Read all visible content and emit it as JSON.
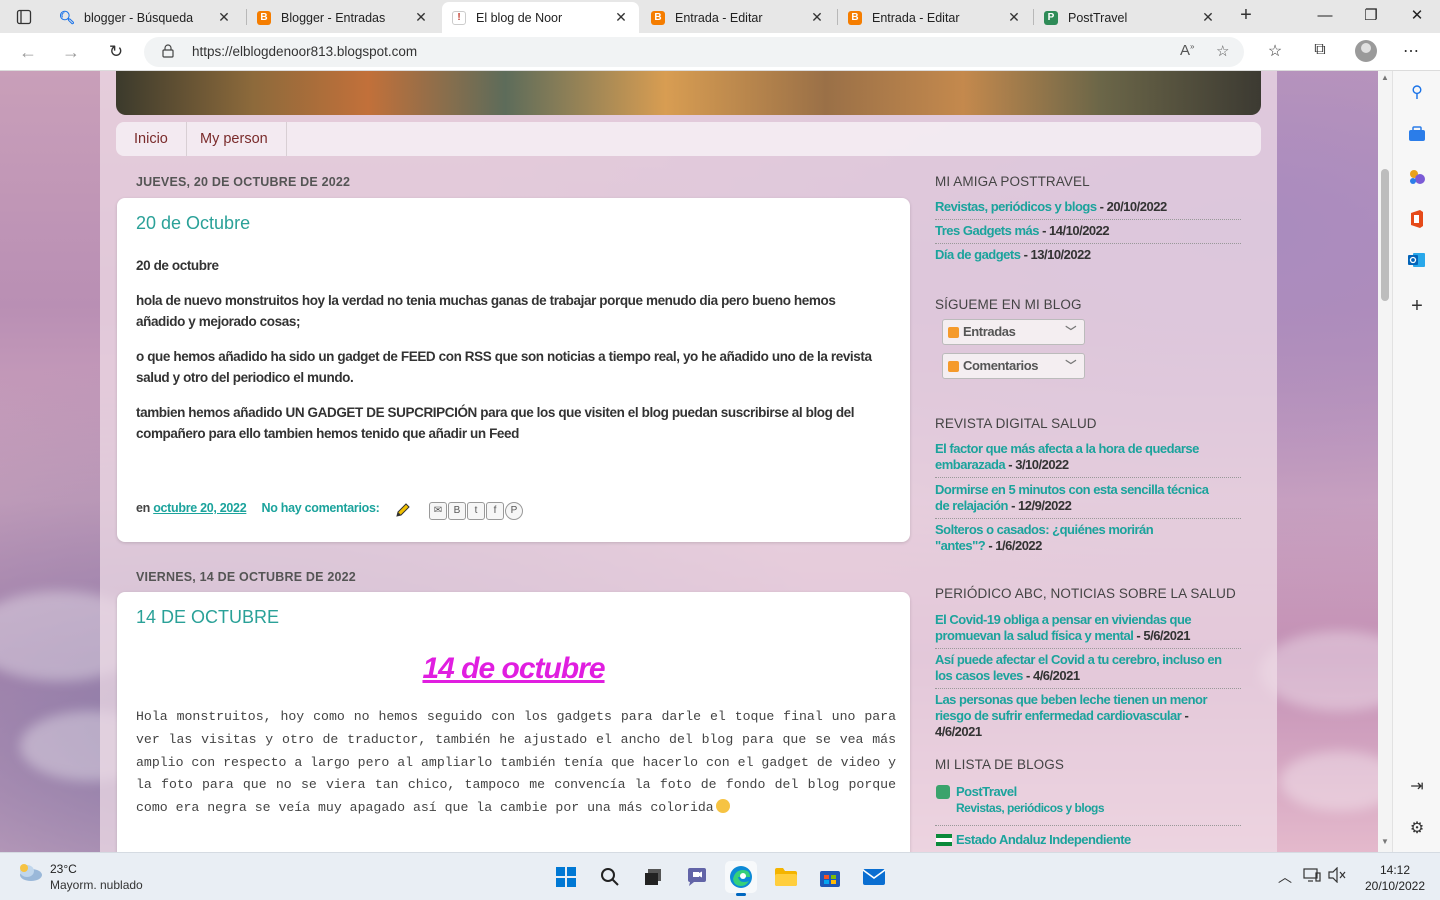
{
  "browser": {
    "tabs": [
      {
        "title": "blogger - Búsqueda",
        "favicon": "search-icon",
        "color": "#1a73e8",
        "active": false
      },
      {
        "title": "Blogger - Entradas",
        "favicon": "blogger-icon",
        "color": "#f57d00",
        "active": false
      },
      {
        "title": "El blog de Noor",
        "favicon": "blog-icon",
        "color": "#c0392b",
        "active": true
      },
      {
        "title": "Entrada - Editar",
        "favicon": "blogger-icon",
        "color": "#f57d00",
        "active": false
      },
      {
        "title": "Entrada - Editar",
        "favicon": "blogger-icon",
        "color": "#f57d00",
        "active": false
      },
      {
        "title": "PostTravel",
        "favicon": "posttravel-icon",
        "color": "#2e8b57",
        "active": false
      }
    ],
    "url": "https://elblogdenoor813.blogspot.com"
  },
  "blog": {
    "nav": [
      "Inicio",
      "My person"
    ],
    "post1": {
      "date_header": "JUEVES, 20 DE OCTUBRE DE 2022",
      "title": "20 de Octubre",
      "paragraphs": [
        " 20 de octubre",
        "hola de nuevo monstruitos hoy la verdad no tenia muchas ganas de trabajar porque menudo dia pero bueno hemos añadido y mejorado cosas;",
        "o que hemos añadido ha sido un gadget de FEED con RSS que son noticias a tiempo real, yo he añadido uno de la revista salud y otro del periodico el mundo.",
        "tambien hemos añadido UN GADGET DE SUPCRIPCIÓN para que los que visiten el blog puedan suscribirse al blog del compañero para ello tambien hemos tenido que añadir un Feed"
      ],
      "footer_prefix": "en",
      "footer_date": "octubre 20, 2022",
      "footer_comments": "No hay comentarios:"
    },
    "post2": {
      "date_header": "VIERNES, 14 DE OCTUBRE DE 2022",
      "title": "14 DE OCTUBRE",
      "big_title": "14 de octubre",
      "body": "Hola monstruitos, hoy como no hemos seguido con los gadgets para darle el toque final uno para ver las visitas y otro de traductor, también he ajustado el ancho del blog para que se vea más amplio con respecto a largo pero al ampliarlo también tenía que hacerlo con el gadget de video y la foto para que no se viera tan chico, tampoco me convencía la foto de fondo del blog porque como era negra se veía muy apagado así que la cambie por una más colorida"
    },
    "sidebar": {
      "amiga": {
        "heading": "MI AMIGA POSTTRAVEL",
        "items": [
          {
            "link": "Revistas, periódicos y blogs",
            "date": " - 20/10/2022"
          },
          {
            "link": "Tres Gadgets más",
            "date": " - 14/10/2022"
          },
          {
            "link": "Día de gadgets",
            "date": " - 13/10/2022"
          }
        ]
      },
      "siguenos": {
        "heading": "SÍGUEME EN MI BLOG",
        "buttons": [
          "Entradas",
          "Comentarios"
        ]
      },
      "revista": {
        "heading": "REVISTA DIGITAL SALUD",
        "items": [
          {
            "link": "El factor que más afecta a la hora de quedarse embarazada",
            "date": " - 3/10/2022"
          },
          {
            "link": "Dormirse en 5 minutos con esta sencilla técnica de relajación",
            "date": " - 12/9/2022"
          },
          {
            "link": "Solteros o casados: ¿quiénes morirán \"antes\"?",
            "date": " - 1/6/2022"
          }
        ]
      },
      "periodico": {
        "heading": "PERIÓDICO ABC, NOTICIAS SOBRE LA SALUD",
        "items": [
          {
            "link": "El Covid-19 obliga a pensar en viviendas que promuevan la salud física y mental",
            "date": " - 5/6/2021"
          },
          {
            "link": "Así puede afectar el Covid a tu cerebro, incluso en los casos leves",
            "date": " - 4/6/2021"
          },
          {
            "link": "Las personas que beben leche tienen un menor riesgo de sufrir enfermedad cardiovascular",
            "date": " - 4/6/2021"
          }
        ]
      },
      "lista": {
        "heading": "MI LISTA DE BLOGS",
        "items": [
          {
            "name": "PostTravel",
            "sub": "Revistas, periódicos y blogs"
          },
          {
            "name": "Estado Andaluz Independiente",
            "sub": ""
          }
        ]
      }
    }
  },
  "taskbar": {
    "weather_temp": "23°C",
    "weather_desc": "Mayorm. nublado",
    "time": "14:12",
    "date": "20/10/2022"
  }
}
